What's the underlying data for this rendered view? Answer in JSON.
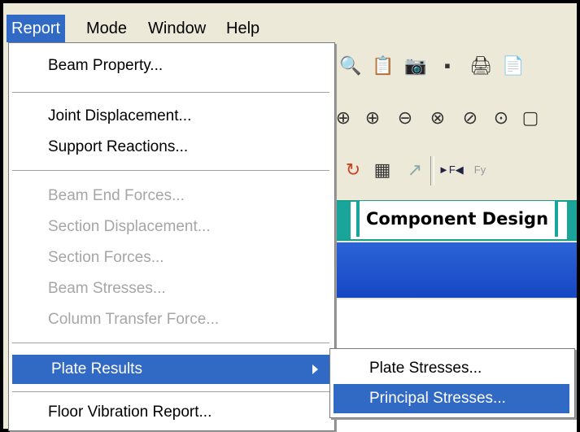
{
  "menubar": {
    "items": [
      {
        "label": "Report",
        "active": true
      },
      {
        "label": "Mode",
        "active": false
      },
      {
        "label": "Window",
        "active": false
      },
      {
        "label": "Help",
        "active": false
      }
    ]
  },
  "background": {
    "tab_label": "Component Design",
    "toolbar_row1": [
      "print-preview-icon",
      "clipboard-icon",
      "camera-icon",
      "export-icon",
      "print-icon",
      "page-icon"
    ],
    "toolbar_row2": [
      "zoom-icon",
      "zoom-in-icon",
      "zoom-out-icon",
      "zoom-window-icon",
      "zoom-dynamic-icon",
      "zoom-fit-icon",
      "pan-icon"
    ],
    "toolbar_row3": [
      "rotate-icon",
      "grid-icon",
      "snap-icon",
      "force-fx-icon",
      "force-fy-icon"
    ]
  },
  "report_menu": {
    "items": [
      {
        "label": "Beam Property...",
        "enabled": true
      },
      {
        "label": "Joint Displacement...",
        "enabled": true
      },
      {
        "label": "Support Reactions...",
        "enabled": true
      },
      {
        "label": "Beam End Forces...",
        "enabled": false
      },
      {
        "label": "Section Displacement...",
        "enabled": false
      },
      {
        "label": "Section Forces...",
        "enabled": false
      },
      {
        "label": "Beam Stresses...",
        "enabled": false
      },
      {
        "label": "Column Transfer Force...",
        "enabled": false
      },
      {
        "label": "Plate Results",
        "enabled": true,
        "submenu": true,
        "highlighted": true
      },
      {
        "label": "Floor Vibration Report...",
        "enabled": true
      }
    ]
  },
  "plate_submenu": {
    "items": [
      {
        "label": "Plate Stresses...",
        "highlighted": false
      },
      {
        "label": "Principal Stresses...",
        "highlighted": true
      }
    ]
  },
  "colors": {
    "highlight": "#316ac5",
    "disabled_text": "#a6a6a6",
    "tab_accent": "#19a599"
  }
}
